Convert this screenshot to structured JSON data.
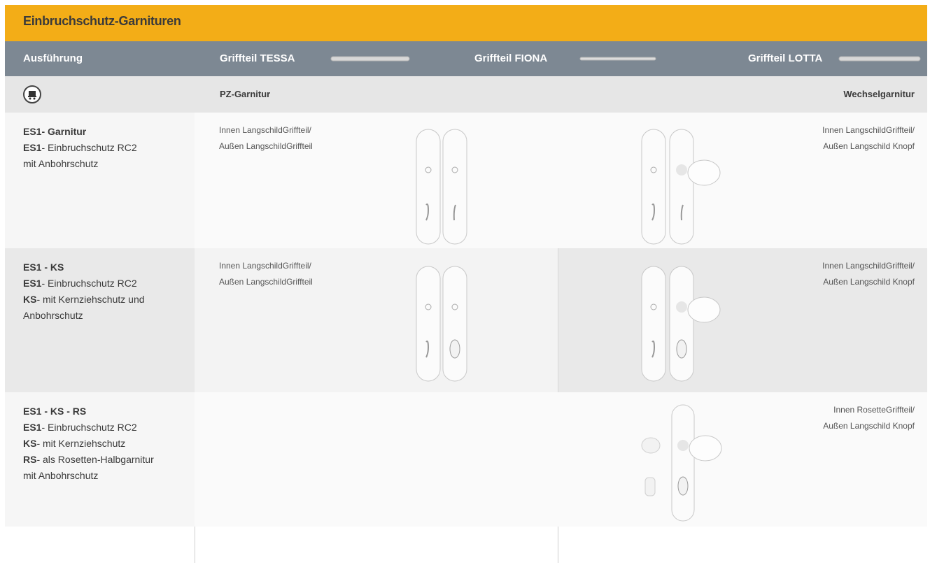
{
  "header": {
    "title": "Einbruchschutz-Garnituren"
  },
  "columns": {
    "ausfuehrung": "Ausführung",
    "tessa": "Griffteil  TESSA",
    "fiona": "Griffteil  FIONA",
    "lotta": "Griffteil  LOTTA"
  },
  "subheader": {
    "cart_icon": "cart-icon",
    "pz": "PZ-Garnitur",
    "wechsel": "Wechselgarnitur"
  },
  "rows": [
    {
      "title": "ES1- Garnitur",
      "lines": [
        {
          "bold": "ES1",
          "text": "- Einbruchschutz  RC2"
        },
        {
          "bold": "",
          "text": "mit  Anbohrschutz"
        }
      ],
      "left_desc": [
        "Innen LangschildGriffteil/",
        "Außen LangschildGriffteil"
      ],
      "right_desc": [
        "Innen LangschildGriffteil/",
        "Außen Langschild Knopf"
      ]
    },
    {
      "title": "ES1 - KS",
      "lines": [
        {
          "bold": "ES1",
          "text": "- Einbruchschutz  RC2"
        },
        {
          "bold": "KS",
          "text": "- mit  Kernziehschutz und"
        },
        {
          "bold": "",
          "text": "Anbohrschutz"
        }
      ],
      "left_desc": [
        "Innen LangschildGriffteil/",
        "Außen LangschildGriffteil"
      ],
      "right_desc": [
        "Innen LangschildGriffteil/",
        "Außen Langschild Knopf"
      ]
    },
    {
      "title": "ES1 - KS - RS",
      "lines": [
        {
          "bold": "ES1",
          "text": "- Einbruchschutz  RC2"
        },
        {
          "bold": "KS",
          "text": "- mit  Kernziehschutz"
        },
        {
          "bold": "RS",
          "text": "- als Rosetten-Halbgarnitur"
        },
        {
          "bold": "",
          "text": "mit  Anbohrschutz"
        }
      ],
      "left_desc": [],
      "right_desc": [
        "Innen RosetteGriffteil/",
        "Außen Langschild Knopf"
      ]
    }
  ]
}
